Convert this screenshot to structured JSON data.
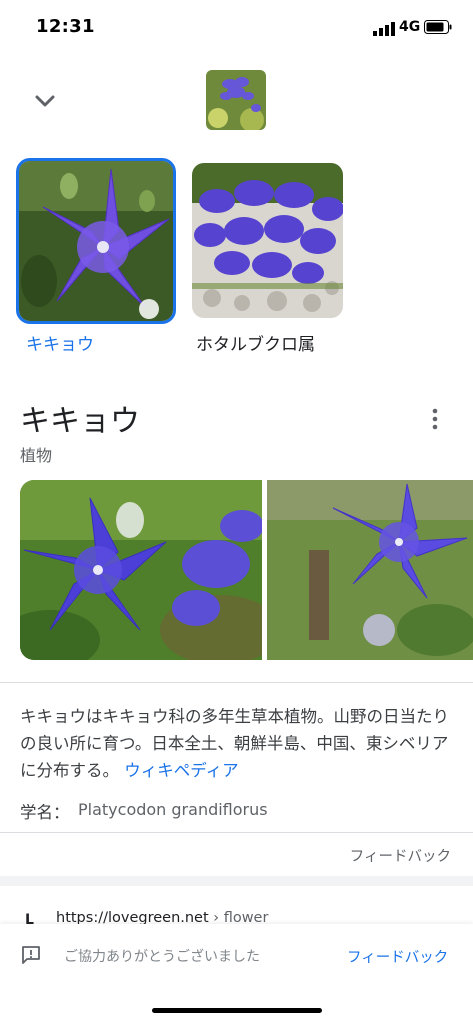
{
  "status_bar": {
    "time": "12:31",
    "network": "4G",
    "icons": [
      "signal-icon",
      "battery-icon"
    ]
  },
  "header": {
    "icons": [
      "chevron-down-icon"
    ],
    "query_thumbnail": "platycodon-flower-thumbnail"
  },
  "candidates": [
    {
      "label": "キキョウ",
      "selected": true
    },
    {
      "label": "ホタルブクロ属",
      "selected": false
    }
  ],
  "knowledge_panel": {
    "title": "キキョウ",
    "subtitle": "植物",
    "description": "キキョウはキキョウ科の多年生草本植物。山野の日当たりの良い所に育つ。日本全土、朝鮮半島、中国、東シベリアに分布する。",
    "source_link": "ウィキペディア",
    "scientific_name_label": "学名：",
    "scientific_name": "Platycodon grandiflorus",
    "feedback_label": "フィードバック"
  },
  "result": {
    "url": "https://lovegreen.net",
    "path": " › flower"
  },
  "bottom_feedback": {
    "message": "ご協力ありがとうございました",
    "link": "フィードバック"
  },
  "colors": {
    "accent": "#1a73e8",
    "flower": "#5b4fd6",
    "text_secondary": "#5f6368"
  }
}
